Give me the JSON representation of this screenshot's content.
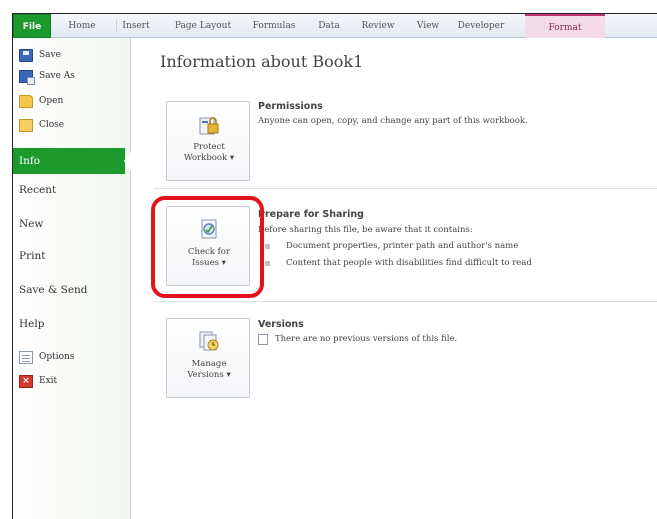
{
  "ribbon": {
    "tabs": [
      "File",
      "Home",
      "Insert",
      "Page Layout",
      "Formulas",
      "Data",
      "Review",
      "View",
      "Developer",
      "Format"
    ]
  },
  "nav": {
    "small_top": [
      {
        "label": "Save",
        "icon": "save-icon"
      },
      {
        "label": "Save As",
        "icon": "save-as-icon"
      },
      {
        "label": "Open",
        "icon": "open-folder-icon"
      },
      {
        "label": "Close",
        "icon": "close-folder-icon"
      }
    ],
    "selected": "Info",
    "big": [
      "Recent",
      "New",
      "Print",
      "Save & Send",
      "Help"
    ],
    "small_bottom": [
      {
        "label": "Options",
        "icon": "options-icon"
      },
      {
        "label": "Exit",
        "icon": "exit-icon"
      }
    ]
  },
  "main": {
    "title": "Information about Book1",
    "permissions": {
      "button_line1": "Protect",
      "button_line2": "Workbook ▾",
      "heading": "Permissions",
      "text": "Anyone can open, copy, and change any part of this workbook."
    },
    "prepare": {
      "button_line1": "Check for",
      "button_line2": "Issues ▾",
      "heading": "Prepare for Sharing",
      "text": "Before sharing this file, be aware that it contains:",
      "bullets": [
        "Document properties, printer path and author's name",
        "Content that people with disabilities find difficult to read"
      ]
    },
    "versions": {
      "button_line1": "Manage",
      "button_line2": "Versions ▾",
      "heading": "Versions",
      "text": "There are no previous versions of this file."
    }
  },
  "colors": {
    "file_tab": "#1d9a2e",
    "highlight": "#e3131b",
    "format_tab": "#f3dbe7"
  }
}
